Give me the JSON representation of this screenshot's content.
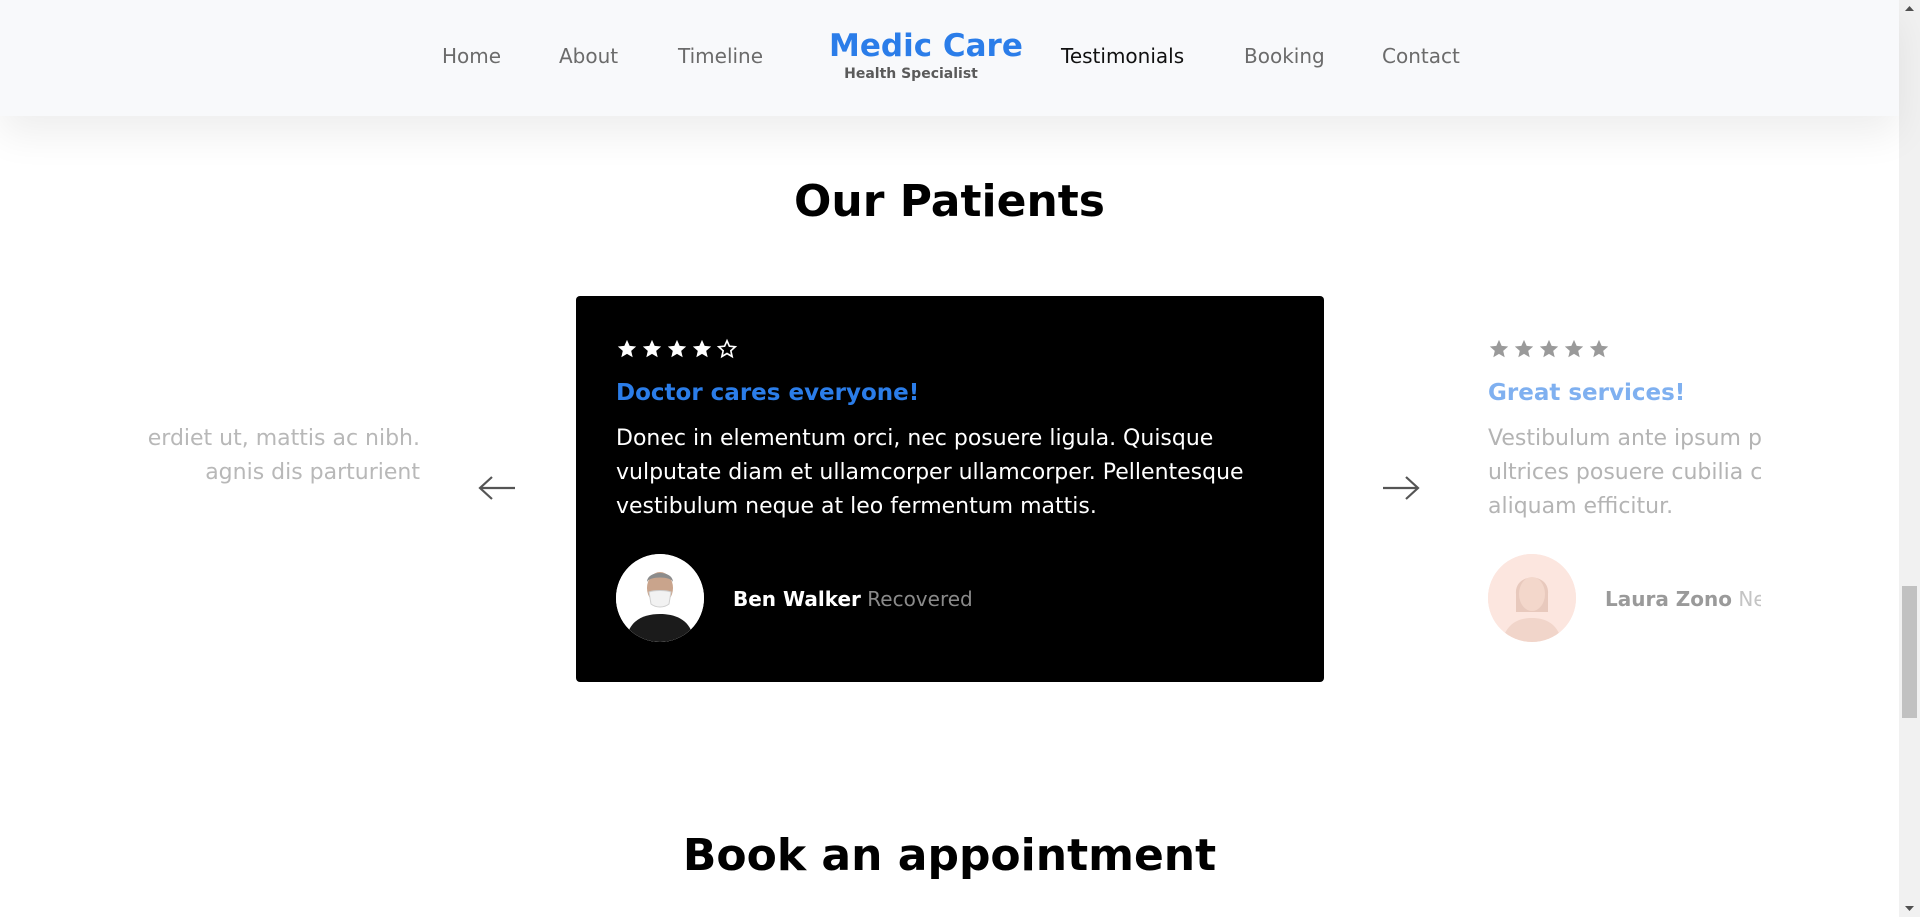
{
  "nav": {
    "links": [
      "Home",
      "About",
      "Timeline",
      "Testimonials",
      "Booking",
      "Contact"
    ],
    "active": "Testimonials",
    "brand_title": "Medic Care",
    "brand_subtitle": "Health Specialist"
  },
  "testimonials": {
    "title": "Our Patients",
    "previous_slide": {
      "line1": "erdiet ut, mattis ac nibh.",
      "line2": "agnis dis parturient"
    },
    "current": {
      "rating": 4,
      "max_rating": 5,
      "heading": "Doctor cares everyone!",
      "body": "Donec in elementum orci, nec posuere ligula. Quisque vulputate diam et ullamcorper ullamcorper. Pellentesque vestibulum neque at leo fermentum mattis.",
      "author_name": "Ben Walker",
      "author_status": "Recovered"
    },
    "next_slide": {
      "rating": 5,
      "heading": "Great services!",
      "line1": "Vestibulum ante ipsum primis",
      "line2": "ultrices posuere cubilia curae",
      "line3": "aliquam efficitur.",
      "author_name": "Laura Zono",
      "author_status": "New"
    },
    "prev_arrow_icon": "arrow-left-icon",
    "next_arrow_icon": "arrow-right-icon"
  },
  "booking": {
    "title": "Book an appointment"
  },
  "colors": {
    "brand": "#2b7de9",
    "card_background": "#000000",
    "header_background": "#f8f9fb"
  }
}
